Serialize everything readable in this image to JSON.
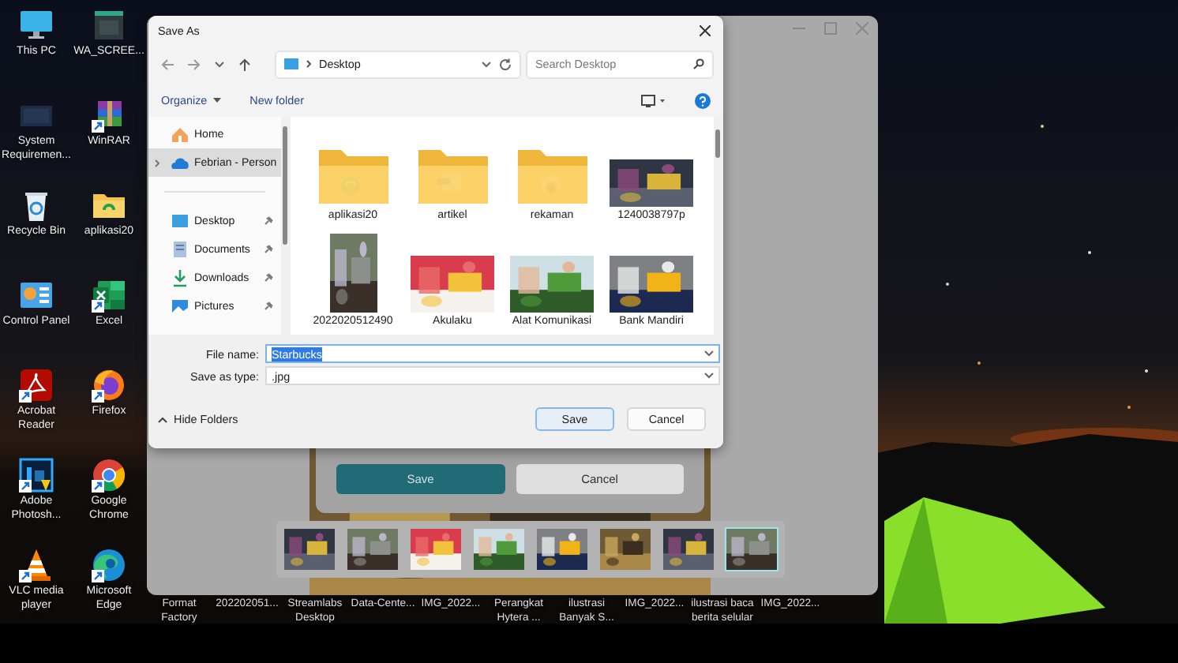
{
  "desktop_icons": [
    {
      "label": "This PC",
      "kind": "pc",
      "shortcut": false
    },
    {
      "label": "WA_SCREE...",
      "kind": "screenshot",
      "shortcut": false
    },
    {
      "label": "System Requiremen...",
      "kind": "dark-file",
      "shortcut": false
    },
    {
      "label": "WinRAR",
      "kind": "archive",
      "shortcut": true
    },
    {
      "label": "Recycle Bin",
      "kind": "bin",
      "shortcut": false
    },
    {
      "label": "aplikasi20",
      "kind": "folder",
      "shortcut": false
    },
    {
      "label": "Control Panel",
      "kind": "panel",
      "shortcut": false
    },
    {
      "label": "Excel",
      "kind": "sheet",
      "shortcut": true
    },
    {
      "label": "Acrobat Reader",
      "kind": "pdf",
      "shortcut": true
    },
    {
      "label": "Firefox",
      "kind": "fox",
      "shortcut": true
    },
    {
      "label": "Adobe Photosh...",
      "kind": "ps",
      "shortcut": true
    },
    {
      "label": "Google Chrome",
      "kind": "chrome",
      "shortcut": true
    },
    {
      "label": "VLC media player",
      "kind": "cone",
      "shortcut": true
    },
    {
      "label": "Microsoft Edge",
      "kind": "edge",
      "shortcut": true
    }
  ],
  "desktop_bottom_labels": [
    "Format Factory",
    "202202051...",
    "Streamlabs Desktop",
    "Data-Cente...",
    "IMG_2022...",
    "Perangkat Hytera ...",
    "ilustrasi Banyak S...",
    "IMG_2022...",
    "ilustrasi baca berita selular",
    "IMG_2022..."
  ],
  "background_window": {
    "buttons": [
      {
        "label": "Save",
        "kind": "primary"
      },
      {
        "label": "Cancel",
        "kind": "secondary"
      }
    ],
    "filmstrip": [
      {
        "selected": false
      },
      {
        "selected": false
      },
      {
        "selected": false
      },
      {
        "selected": false
      },
      {
        "selected": false
      },
      {
        "selected": false
      },
      {
        "selected": false
      },
      {
        "selected": true
      }
    ]
  },
  "dialog": {
    "title": "Save As",
    "address": {
      "path": "Desktop"
    },
    "search": {
      "placeholder": "Search Desktop"
    },
    "toolbar": {
      "organize": "Organize",
      "new_folder": "New folder"
    },
    "sidebar": {
      "top": [
        {
          "label": "Home",
          "kind": "home",
          "selected": false,
          "expandable": false
        },
        {
          "label": "Febrian - Person",
          "kind": "cloud",
          "selected": true,
          "expandable": true
        }
      ],
      "quick_access": [
        {
          "label": "Desktop",
          "kind": "desktop",
          "pinned": true
        },
        {
          "label": "Documents",
          "kind": "documents",
          "pinned": true
        },
        {
          "label": "Downloads",
          "kind": "downloads",
          "pinned": true
        },
        {
          "label": "Pictures",
          "kind": "pictures",
          "pinned": true
        }
      ]
    },
    "files": [
      {
        "name": "aplikasi20",
        "kind": "chat-folder"
      },
      {
        "name": "artikel",
        "kind": "document-folder"
      },
      {
        "name": "rekaman",
        "kind": "photo-folder"
      },
      {
        "name": "1240038797p",
        "kind": "picture"
      },
      {
        "name": "2022020512490",
        "kind": "picture"
      },
      {
        "name": "Akulaku",
        "kind": "picture"
      },
      {
        "name": "Alat Komunikasi",
        "kind": "picture"
      },
      {
        "name": "Bank Mandiri",
        "kind": "picture"
      }
    ],
    "file_name": {
      "label": "File name:",
      "value": "Starbucks",
      "text_highlighted": true
    },
    "save_as_type": {
      "label": "Save as type:",
      "value": ".jpg"
    },
    "hide_folders": "Hide Folders",
    "buttons": [
      {
        "label": "Save",
        "kind": "primary"
      },
      {
        "label": "Cancel",
        "kind": "secondary"
      }
    ]
  }
}
